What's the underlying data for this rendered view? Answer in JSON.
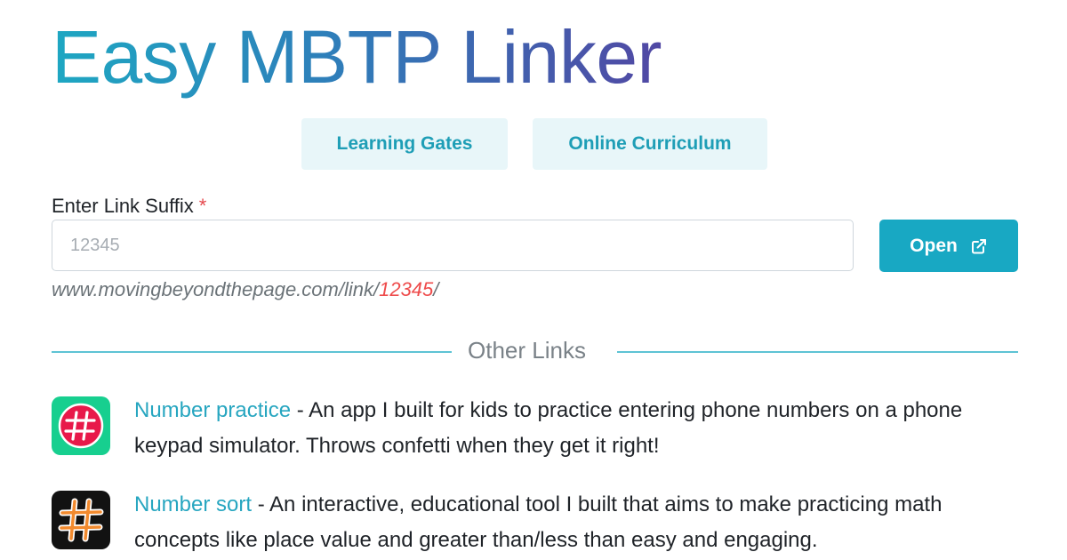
{
  "header": {
    "title": "Easy MBTP Linker"
  },
  "tabs": [
    {
      "label": "Learning Gates"
    },
    {
      "label": "Online Curriculum"
    }
  ],
  "link_form": {
    "label": "Enter Link Suffix",
    "required_marker": "*",
    "input_value": "",
    "input_placeholder": "12345",
    "open_button_label": "Open",
    "url_prefix": "www.movingbeyondthepage.com/link/",
    "url_suffix": "12345",
    "url_trailing": "/"
  },
  "other_links": {
    "heading": "Other Links",
    "items": [
      {
        "name": "Number practice",
        "icon": "number-practice-app-icon",
        "description": " - An app I built for kids to practice entering phone numbers on a phone keypad simulator. Throws confetti when they get it right!"
      },
      {
        "name": "Number sort",
        "icon": "number-sort-app-icon",
        "description": " - An interactive, educational tool I built that aims to make practicing math concepts like place value and greater than/less than easy and engaging."
      }
    ]
  },
  "colors": {
    "accent": "#18a8c3",
    "tab_bg": "#e8f6f9",
    "required": "#e5484d",
    "url_suffix": "#ee4b4b",
    "title_gradient_start": "#1ea7c2",
    "title_gradient_end": "#5148a4"
  }
}
